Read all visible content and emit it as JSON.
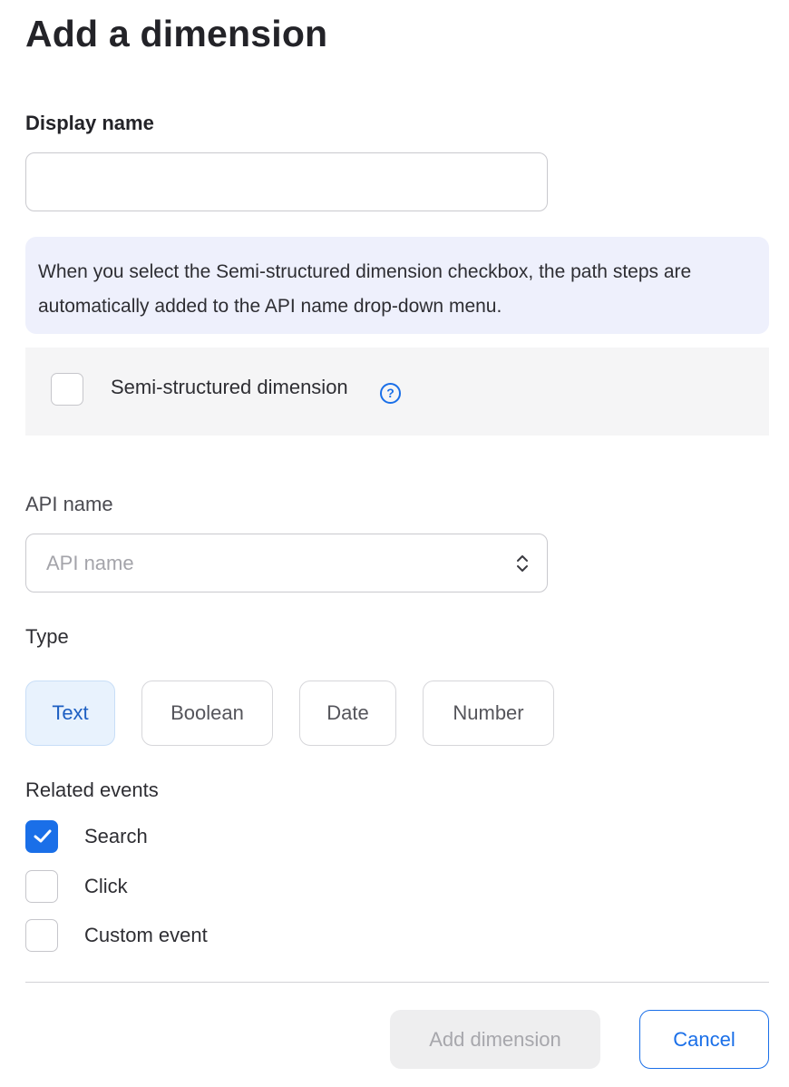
{
  "dialog": {
    "title": "Add a dimension"
  },
  "display_name": {
    "label": "Display name",
    "value": "",
    "placeholder": ""
  },
  "info_message": "When you select the Semi-structured dimension checkbox, the path steps are automatically added to the API name drop-down menu.",
  "semi_structured": {
    "label": "Semi-structured dimension",
    "checked": false,
    "help_icon": "question-circle-icon",
    "help_glyph": "?"
  },
  "api_name": {
    "label": "API name",
    "placeholder": "API name"
  },
  "type": {
    "label": "Type",
    "options": [
      "Text",
      "Boolean",
      "Date",
      "Number"
    ],
    "selected": "Text"
  },
  "related_events": {
    "label": "Related events",
    "items": [
      {
        "label": "Search",
        "checked": true
      },
      {
        "label": "Click",
        "checked": false
      },
      {
        "label": "Custom event",
        "checked": false
      }
    ]
  },
  "footer": {
    "add_label": "Add dimension",
    "add_disabled": true,
    "cancel_label": "Cancel"
  },
  "colors": {
    "accent": "#1a6fe8",
    "info_bg": "#eef0fc",
    "selected_type_bg": "#e8f2fd"
  }
}
